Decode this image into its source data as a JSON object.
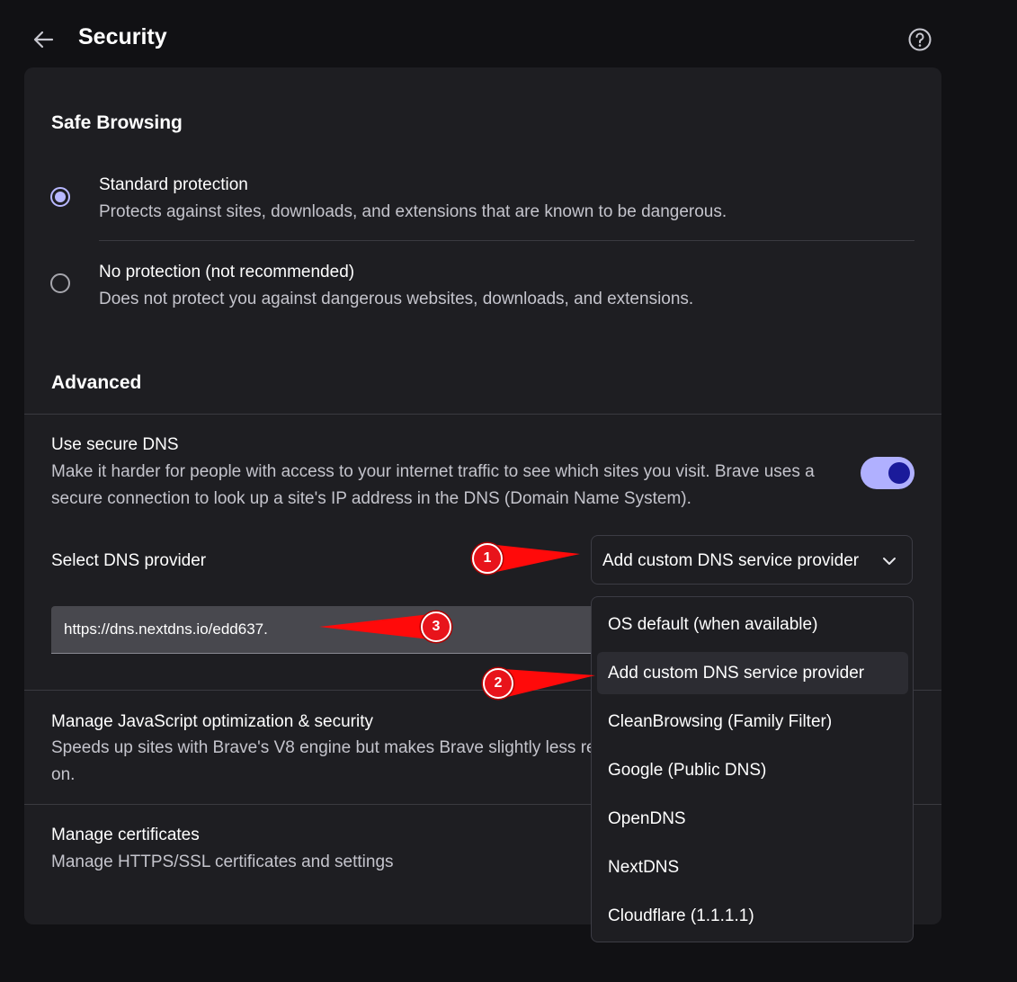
{
  "header": {
    "title": "Security"
  },
  "safe_browsing": {
    "heading": "Safe Browsing",
    "options": [
      {
        "label": "Standard protection",
        "description": "Protects against sites, downloads, and extensions that are known to be dangerous.",
        "checked": true
      },
      {
        "label": "No protection (not recommended)",
        "description": "Does not protect you against dangerous websites, downloads, and extensions.",
        "checked": false
      }
    ]
  },
  "advanced": {
    "heading": "Advanced",
    "secure_dns": {
      "title": "Use secure DNS",
      "description": "Make it harder for people with access to your internet traffic to see which sites you visit. Brave uses a secure connection to look up a site's IP address in the DNS (Domain Name System).",
      "enabled": true
    },
    "dns_provider": {
      "label": "Select DNS provider",
      "selected": "Add custom DNS service provider",
      "custom_url": "https://dns.nextdns.io/edd637.",
      "options": [
        "OS default (when available)",
        "Add custom DNS service provider",
        "CleanBrowsing (Family Filter)",
        "Google (Public DNS)",
        "OpenDNS",
        "NextDNS",
        "Cloudflare (1.1.1.1)"
      ]
    },
    "javascript": {
      "title": "Manage JavaScript optimization & security",
      "description": "Speeds up sites with Brave's V8 engine but makes Brave slightly less re",
      "description_line2": "on."
    },
    "certificates": {
      "title": "Manage certificates",
      "description": "Manage HTTPS/SSL certificates and settings"
    }
  },
  "annotations": [
    "1",
    "2",
    "3"
  ],
  "colors": {
    "background": "#111114",
    "card": "#1e1e22",
    "accent": "#b8b8ff",
    "toggle_knob": "#1a1a9a",
    "annotation_red": "#e8141b"
  }
}
